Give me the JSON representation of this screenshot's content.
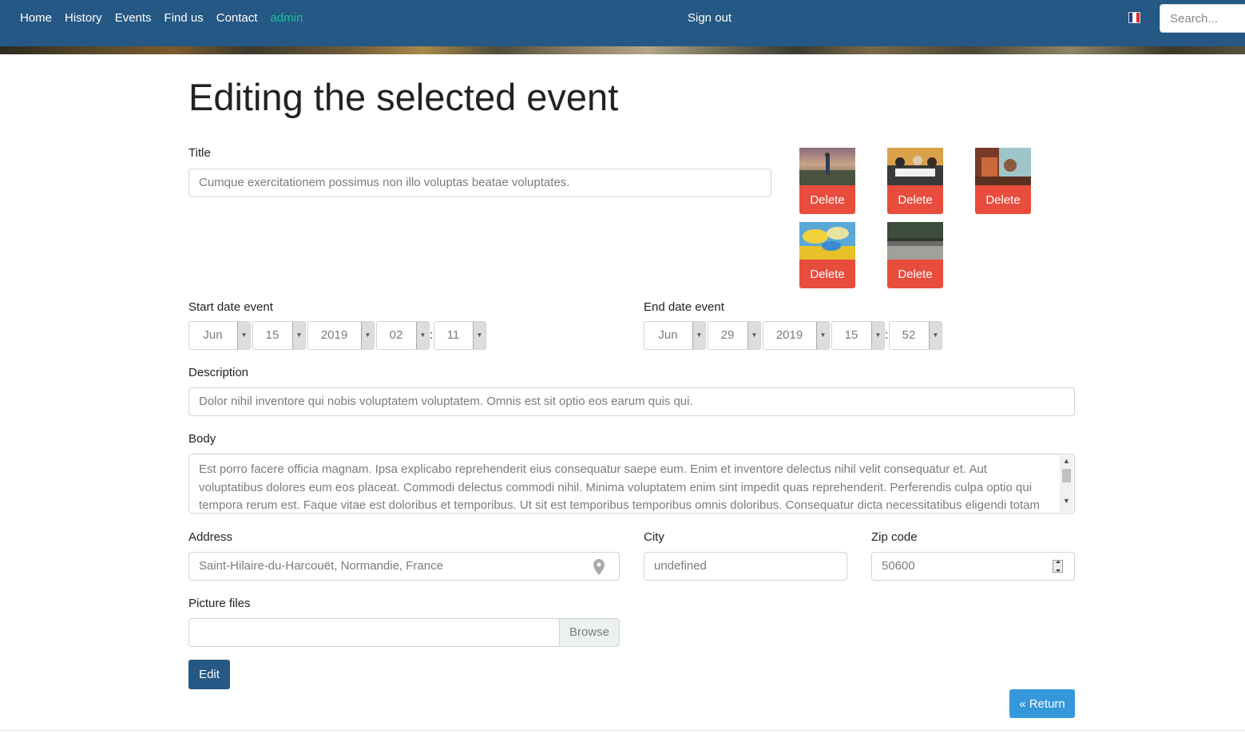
{
  "nav": {
    "links": [
      {
        "label": "Home"
      },
      {
        "label": "History"
      },
      {
        "label": "Events"
      },
      {
        "label": "Find us"
      },
      {
        "label": "Contact"
      }
    ],
    "admin_label": "admin",
    "signout_label": "Sign out",
    "language_flag": "fr-flag-icon",
    "search_placeholder": "Search..."
  },
  "page_title": "Editing the selected event",
  "form": {
    "title_label": "Title",
    "title_value": "Cumque exercitationem possimus non illo voluptas beatae voluptates.",
    "start_label": "Start date event",
    "start": {
      "month": "Jun",
      "day": "15",
      "year": "2019",
      "hour": "02",
      "minute": "11"
    },
    "end_label": "End date event",
    "end": {
      "month": "Jun",
      "day": "29",
      "year": "2019",
      "hour": "15",
      "minute": "52"
    },
    "time_separator": ":",
    "description_label": "Description",
    "description_value": "Dolor nihil inventore qui nobis voluptatem voluptatem. Omnis est sit optio eos earum quis qui.",
    "body_label": "Body",
    "body_value": "Est porro facere officia magnam. Ipsa explicabo reprehenderit eius consequatur saepe eum. Enim et inventore delectus nihil velit consequatur et. Aut voluptatibus dolores eum eos placeat. Commodi delectus commodi nihil. Minima voluptatem enim sint impedit quas reprehenderit. Perferendis culpa optio qui tempora rerum est. Faque vitae est doloribus et temporibus. Ut sit est temporibus temporibus omnis doloribus. Consequatur dicta necessitatibus eligendi totam nam dolores fugit.",
    "address_label": "Address",
    "address_value": "Saint-Hilaire-du-Harcouët, Normandie, France",
    "city_label": "City",
    "city_value": "undefined",
    "zip_label": "Zip code",
    "zip_value": "50600",
    "pictures_label": "Picture files",
    "browse_label": "Browse",
    "edit_label": "Edit",
    "return_label": "« Return"
  },
  "pictures": [
    {
      "delete_label": "Delete"
    },
    {
      "delete_label": "Delete"
    },
    {
      "delete_label": "Delete"
    },
    {
      "delete_label": "Delete"
    },
    {
      "delete_label": "Delete"
    }
  ],
  "colors": {
    "navbar": "#255884",
    "admin": "#1abc9c",
    "delete": "#e74c3c",
    "edit": "#255884",
    "return": "#3498db"
  }
}
